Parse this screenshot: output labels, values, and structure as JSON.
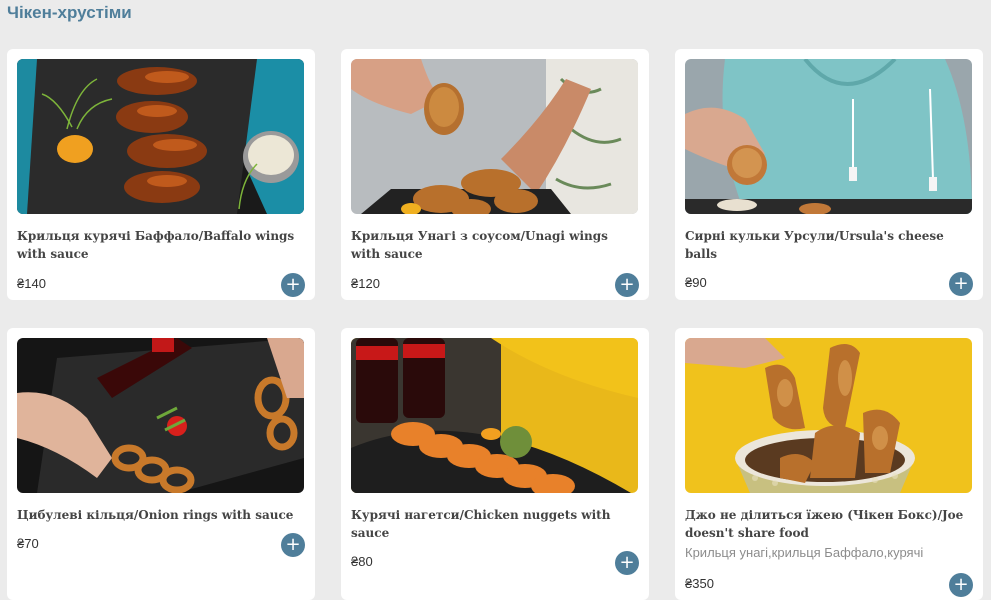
{
  "section": {
    "title": "Чікен-хрустіми"
  },
  "products": [
    {
      "name": "Крильця курячі Баффало/Baffalo wings with sauce",
      "price": "₴140",
      "add_icon": "+"
    },
    {
      "name": "Крильця Унагі з соусом/Unagi wings with sauce",
      "price": "₴120",
      "add_icon": "+"
    },
    {
      "name": "Сирні кульки Урсули/Ursula's cheese balls",
      "price": "₴90",
      "add_icon": "+"
    },
    {
      "name": "Цибулеві кільця/Onion rings with sauce",
      "price": "₴70",
      "add_icon": "+"
    },
    {
      "name": "Курячі нагетси/Chicken nuggets with sauce",
      "price": "₴80",
      "add_icon": "+"
    },
    {
      "name": "Джо не ділиться їжею (Чікен Бокс)/Joe doesn't share food",
      "description": "Крильця унагі,крильця Баффало,курячі",
      "price": "₴350",
      "add_icon": "+"
    }
  ],
  "colors": {
    "accent": "#4f7e9a",
    "background": "#ebebeb",
    "card": "#ffffff"
  }
}
